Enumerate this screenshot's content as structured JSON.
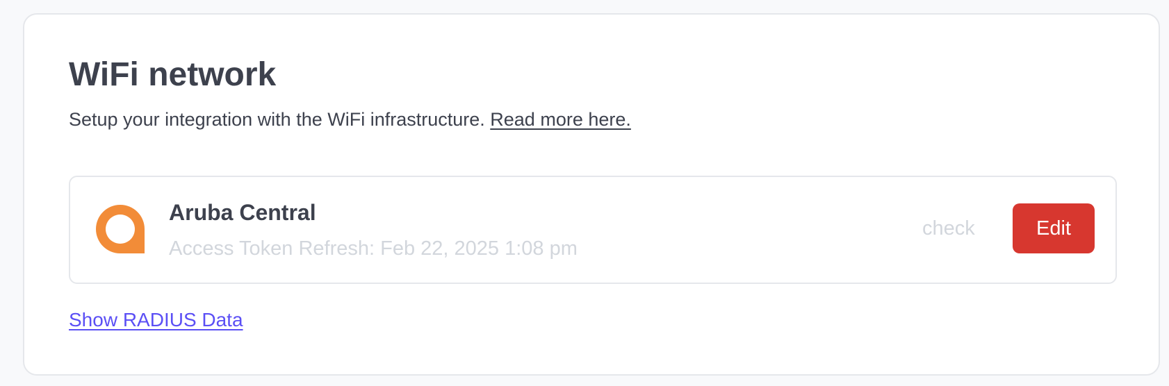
{
  "section": {
    "title": "WiFi network",
    "description": "Setup your integration with the WiFi infrastructure.",
    "read_more_label": "Read more here."
  },
  "integration": {
    "logo_icon": "aruba-logo-icon",
    "logo_color": "#f28c38",
    "name": "Aruba Central",
    "token_refresh_text": "Access Token Refresh: Feb 22, 2025 1:08 pm",
    "check_label": "check",
    "edit_label": "Edit",
    "edit_color": "#d7372f"
  },
  "radius": {
    "toggle_label": "Show RADIUS Data"
  }
}
